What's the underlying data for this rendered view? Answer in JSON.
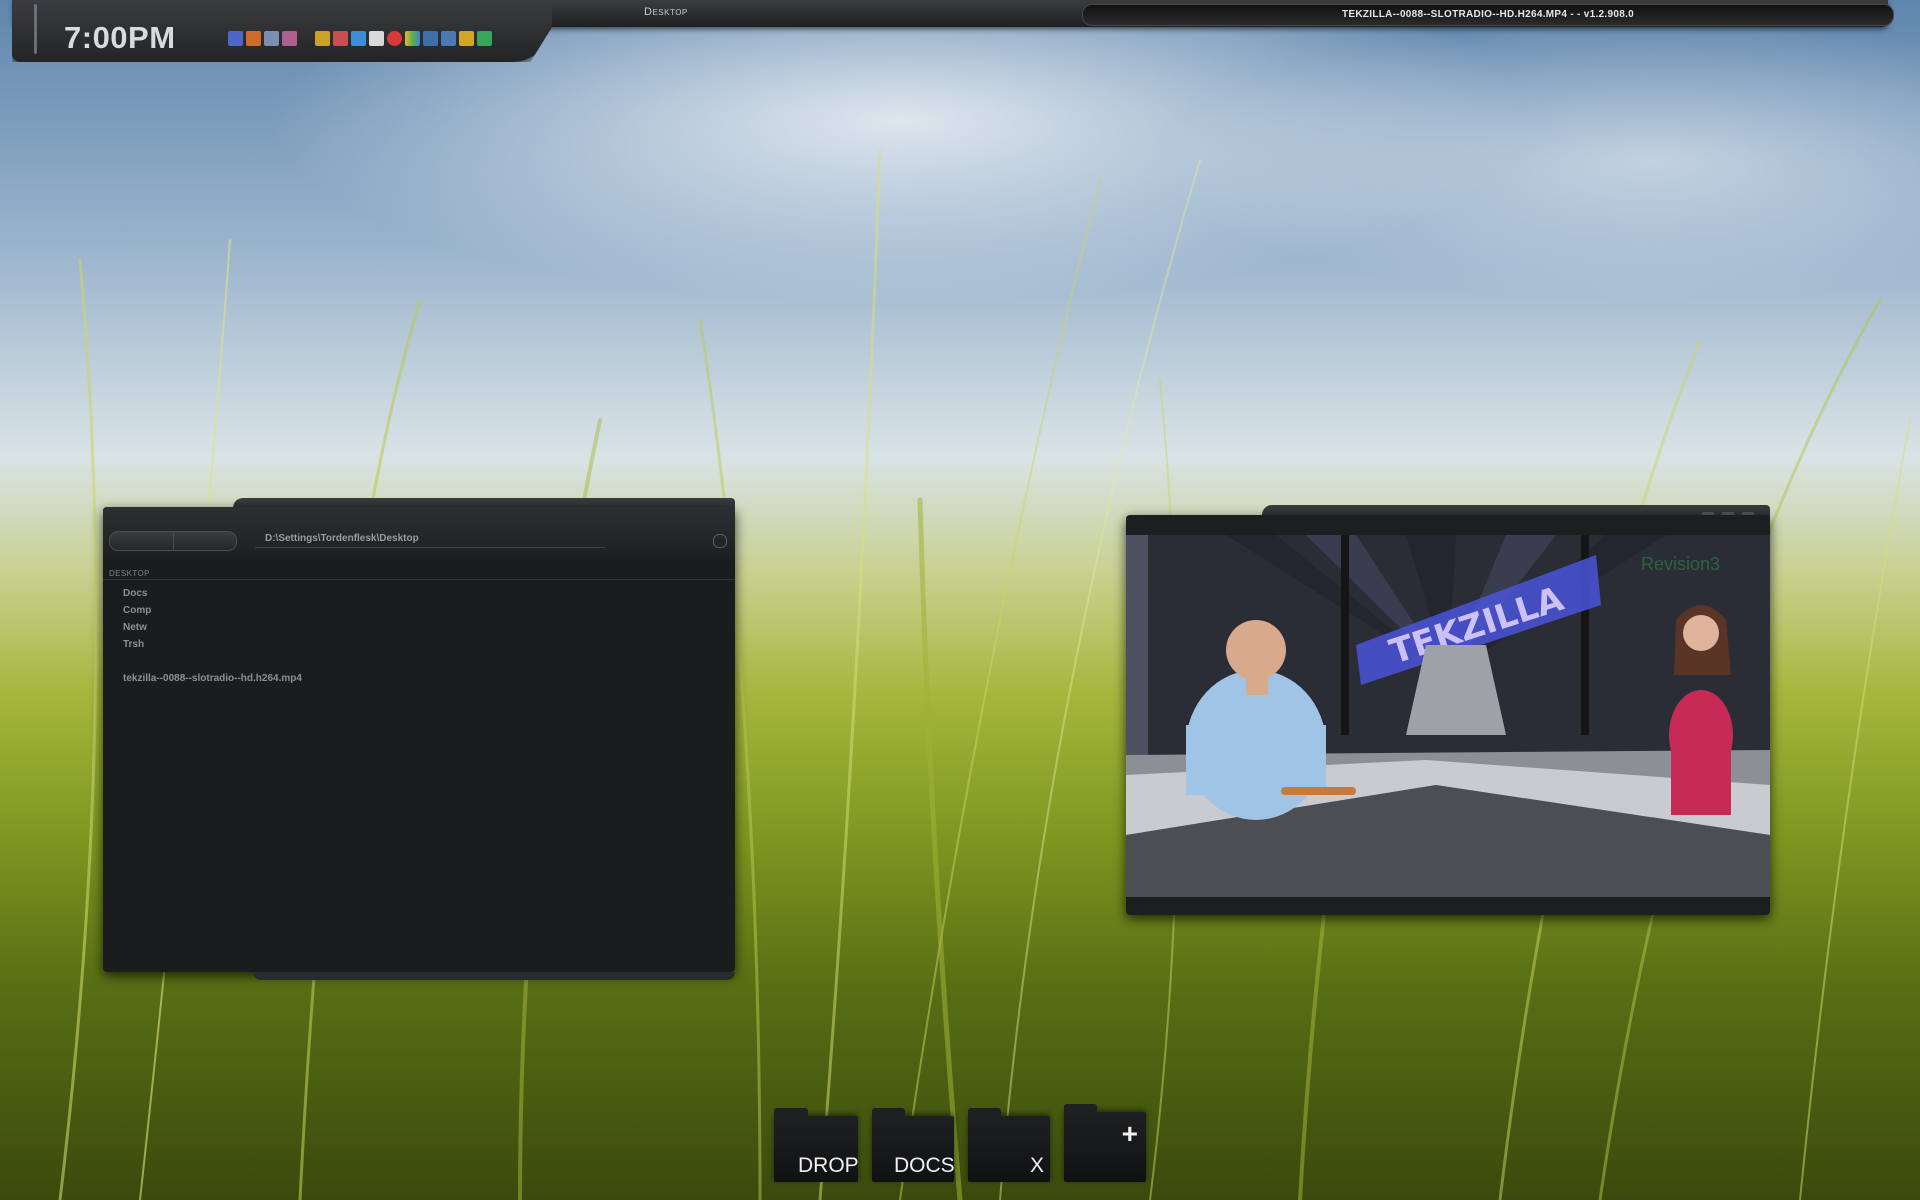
{
  "topbar": {
    "clock": "7:00PM",
    "desktop_label": "Desktop",
    "media_title": "TEKZILLA--0088--SLOTRADIO--HD.H264.MP4 -  - v1.2.908.0",
    "tray_icons": [
      "network-icon",
      "app-tile-icon",
      "volume-icon",
      "invader-icon",
      "s-app-icon",
      "shield-icon",
      "dropbox-icon",
      "v-app-icon",
      "red-circle-icon",
      "multicolor-tile-icon",
      "layout-icon",
      "layout2-icon",
      "bolt-icon",
      "h-app-icon"
    ]
  },
  "explorer": {
    "address": "D:\\Settings\\Tordenflesk\\Desktop",
    "breadcrumb": "DESKTOP",
    "items": [
      "Docs",
      "Comp",
      "Netw",
      "Trsh"
    ],
    "file": "tekzilla--0088--slotradio--hd.h264.mp4"
  },
  "video": {
    "show_title": "TEKZILLA",
    "watermark": "Revision3"
  },
  "dock": {
    "drop": "DROP",
    "docs": "DOCS",
    "x": "X",
    "plus": "+"
  }
}
